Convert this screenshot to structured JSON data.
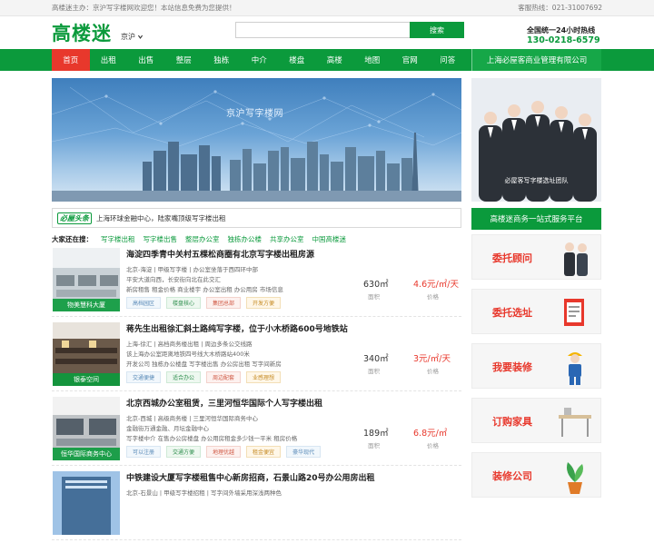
{
  "topbar": {
    "welcome": "高楼迷主办：京沪写字楼网欢迎您！本站信息免费为您提供！",
    "phone": "客服热线：021-31007692"
  },
  "header": {
    "logo": "高楼迷",
    "city": "京沪",
    "search_placeholder": "",
    "search_button": "搜索",
    "hotline_title": "全国统一24小时热线",
    "hotline_number": "130-0218-6579"
  },
  "nav": {
    "items": [
      "首页",
      "出租",
      "出售",
      "整层",
      "独栋",
      "中介",
      "楼盘",
      "高楼",
      "地图",
      "官网",
      "问答"
    ],
    "company": "上海必屋客商业管理有限公司"
  },
  "banner": {
    "title": "京沪写字楼网"
  },
  "side_image": {
    "caption": "必屋客写字楼选址团队"
  },
  "news": {
    "badge": "必屋头条",
    "text": "上海环球金融中心，陆家嘴顶级写字楼出租"
  },
  "hot_search": {
    "label": "大家还在搜：",
    "links": [
      "写字楼出租",
      "写字楼出售",
      "整层办公室",
      "独栋办公楼",
      "共享办公室",
      "中国高楼迷"
    ]
  },
  "service": {
    "title": "高楼迷商务一站式服务平台",
    "items": [
      "委托顾问",
      "委托选址",
      "我要装修",
      "订购家具",
      "装修公司"
    ]
  },
  "listings": [
    {
      "title": "海淀四季青中关村五棵松商圈有北京写字楼出租房源",
      "thumb_caption": "物美慧科大厦",
      "lines": [
        "北京-海淀 | 甲级写字楼 | 办公室坐落于西四环中部",
        "平安大道向西，长安街向北在此交汇",
        "新房租售 租金价格 商业楼宇 办公室出租 办公用房 市场信息"
      ],
      "tags": [
        "高档园区",
        "楼盘核心",
        "集团总部",
        "开发方便"
      ],
      "area": "630㎡",
      "area_label": "面积",
      "price": "4.6元/㎡/天",
      "price_label": "价格"
    },
    {
      "title": "蒋先生出租徐汇斜土路纯写字楼，位于小木桥路600号地铁站",
      "thumb_caption": "银泰空间",
      "lines": [
        "上海-徐汇 | 高档商务楼出租 | 周边多条公交线路",
        "该上海办公室距离地铁四号线大木桥路站400米",
        "开发公司 独栋办公楼盘 写字楼出售 办公房出租 写字间新房"
      ],
      "tags": [
        "交通便捷",
        "适合办公",
        "周边配套",
        "业感理想"
      ],
      "area": "340㎡",
      "area_label": "面积",
      "price": "3元/㎡/天",
      "price_label": "价格"
    },
    {
      "title": "北京西城办公室租赁，三里河恒华国际个人写字楼出租",
      "thumb_caption": "恒华国际商务中心",
      "lines": [
        "北京-西城 | 高级商务楼 | 三里河恒华国际商务中心",
        "金融街万通金融、月坛金融中心",
        "写字楼中介 在售办公房楼盘 办公用房租金多少钱一平米 租房价格"
      ],
      "tags": [
        "可以注册",
        "交通方便",
        "地理优越",
        "租金便宜",
        "豪华现代"
      ],
      "area": "189㎡",
      "area_label": "面积",
      "price": "6.8元/㎡",
      "price_label": "价格"
    },
    {
      "title": "中铁建设大厦写字楼租售中心新房招商，石景山路20号办公用房出租",
      "thumb_caption": "",
      "lines": [
        "北京-石景山 | 甲级写字楼招租 | 写字间外墙采用深浅两种色"
      ],
      "tags": [],
      "area": "",
      "area_label": "",
      "price": "",
      "price_label": ""
    }
  ]
}
